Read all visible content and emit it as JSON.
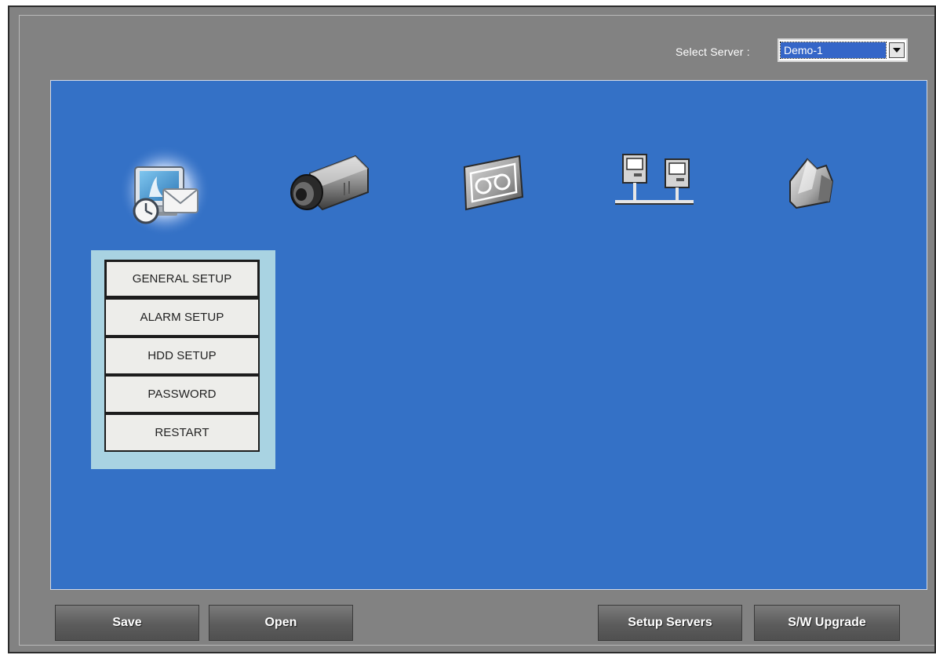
{
  "server": {
    "label": "Select Server :",
    "selected": "Demo-1"
  },
  "categories": [
    {
      "name": "system-setup",
      "icon": "monitor-clock-mail-icon",
      "selected": true
    },
    {
      "name": "camera-setup",
      "icon": "camera-icon",
      "selected": false
    },
    {
      "name": "record-setup",
      "icon": "tape-icon",
      "selected": false
    },
    {
      "name": "network-setup",
      "icon": "network-computers-icon",
      "selected": false
    },
    {
      "name": "utility-setup",
      "icon": "tools-icon",
      "selected": false
    }
  ],
  "submenu": {
    "items": [
      "GENERAL SETUP",
      "ALARM SETUP",
      "HDD SETUP",
      "PASSWORD",
      "RESTART"
    ],
    "selected_index": 0
  },
  "buttons": {
    "save": "Save",
    "open": "Open",
    "setup_servers": "Setup Servers",
    "sw_upgrade": "S/W Upgrade"
  },
  "colors": {
    "panel": "#3471c6",
    "frame": "#828282",
    "submenu_bg": "#a9d3e2",
    "select_highlight": "#3566c8"
  }
}
